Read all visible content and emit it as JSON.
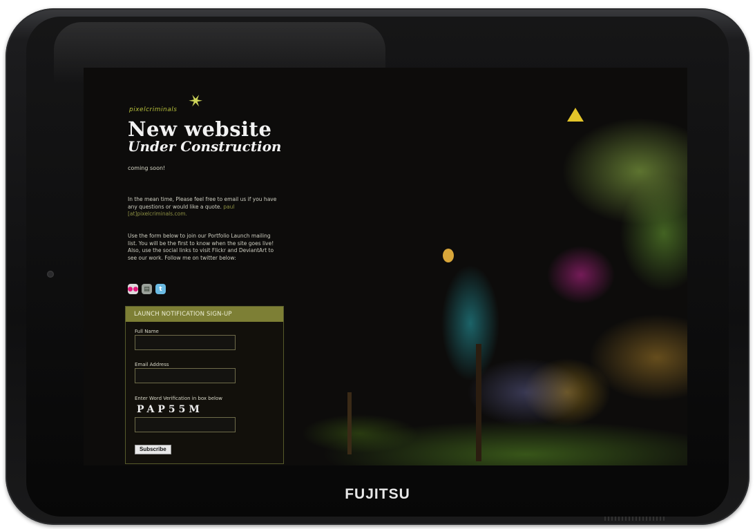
{
  "device": {
    "brand": "FUJITSU"
  },
  "page": {
    "logo_text": "pixelcriminals",
    "title": "New website",
    "subtitle": "Under Construction",
    "coming_soon": "coming soon!",
    "para1_text": "In the mean time, Please feel free to email us if you have any questions or would like a quote.",
    "para1_email": "paul [at]pixelcriminals.com.",
    "para2": "Use the form below to join our Portfolio Launch mailing list. You will be the first to know when the site goes live! Also, use the social links to visit Flickr and DeviantArt to see our work. Follow me on twitter below:",
    "socials": [
      "flickr-icon",
      "deviantart-icon",
      "twitter-icon"
    ]
  },
  "signup": {
    "header": "LAUNCH NOTIFICATION SIGN-UP",
    "full_name_label": "Full Name",
    "email_label": "Email Address",
    "verification_label": "Enter Word Verification in box below",
    "captcha": "PAP55M",
    "subscribe_label": "Subscribe"
  },
  "colors": {
    "accent": "#7d7f35",
    "background": "#0d0c0b",
    "link": "#8e9144"
  }
}
